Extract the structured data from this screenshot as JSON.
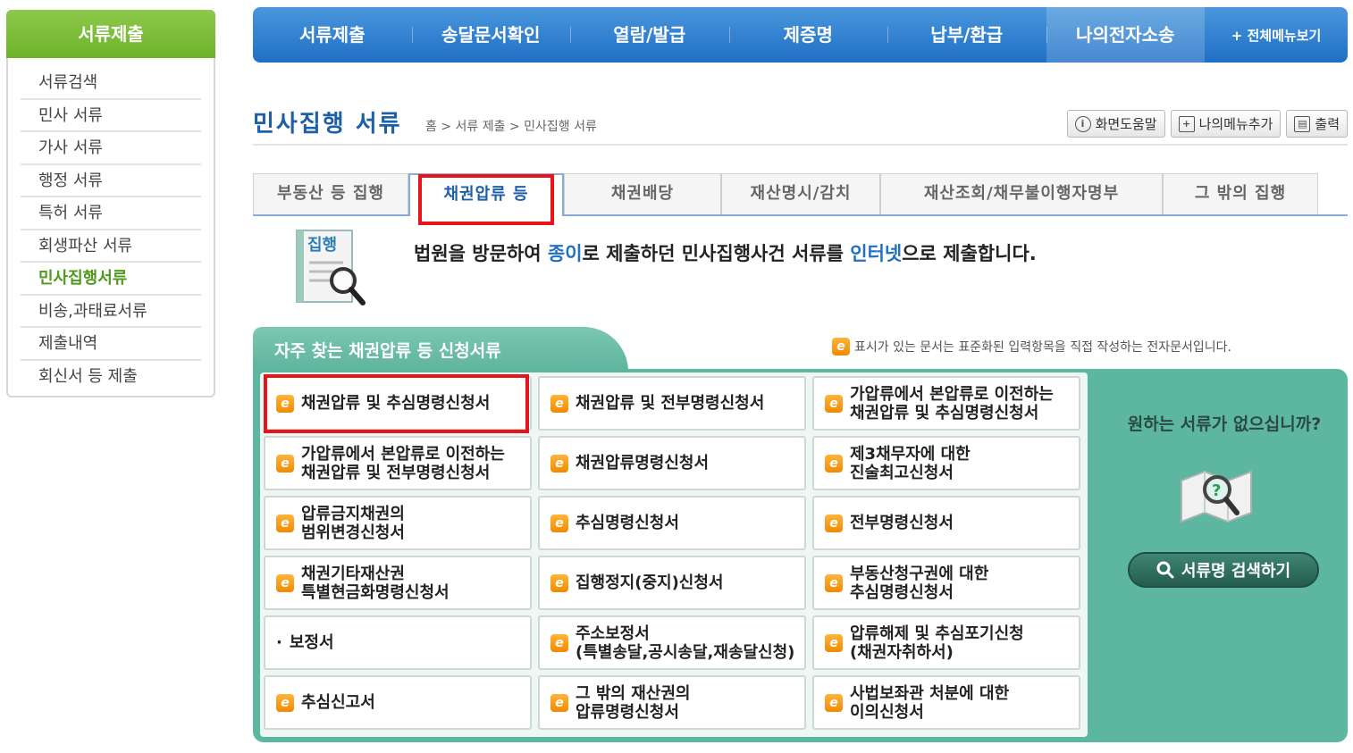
{
  "sidebar": {
    "title": "서류제출",
    "items": [
      {
        "label": "서류검색"
      },
      {
        "label": "민사 서류"
      },
      {
        "label": "가사 서류"
      },
      {
        "label": "행정 서류"
      },
      {
        "label": "특허 서류"
      },
      {
        "label": "회생파산 서류"
      },
      {
        "label": "민사집행서류"
      },
      {
        "label": "비송,과태료서류"
      },
      {
        "label": "제출내역"
      },
      {
        "label": "회신서 등 제출"
      }
    ],
    "active_index": 6
  },
  "topnav": {
    "items": [
      "서류제출",
      "송달문서확인",
      "열람/발급",
      "제증명",
      "납부/환급",
      "나의전자소송"
    ],
    "all_menu": "+ 전체메뉴보기"
  },
  "page": {
    "title": "민사집행 서류",
    "breadcrumb": "홈 > 서류 제출 > 민사집행 서류",
    "tools": {
      "help": "화면도움말",
      "add_menu": "나의메뉴추가",
      "print": "출력"
    }
  },
  "tabs": [
    "부동산 등 집행",
    "채권압류 등",
    "채권배당",
    "재산명시/감치",
    "재산조회/채무불이행자명부",
    "그 밖의 집행"
  ],
  "intro": {
    "icon_label": "집행",
    "text_a": "법원을 방문하여 ",
    "text_hl1": "종이",
    "text_b": "로 제출하던 민사집행사건 서류를 ",
    "text_hl2": "인터넷",
    "text_c": "으로 제출합니다."
  },
  "section": {
    "title": "자주 찾는 채권압류 등 신청서류",
    "note": "표시가 있는 문서는 표준화된 입력항목을 직접 작성하는 전자문서입니다."
  },
  "documents": [
    {
      "label": "채권압류 및 추심명령신청서",
      "icon": "e"
    },
    {
      "label": "채권압류 및 전부명령신청서",
      "icon": "e"
    },
    {
      "label": "가압류에서 본압류로 이전하는\n채권압류 및 추심명령신청서",
      "icon": "e"
    },
    {
      "label": "가압류에서 본압류로 이전하는\n채권압류 및 전부명령신청서",
      "icon": "e"
    },
    {
      "label": "채권압류명령신청서",
      "icon": "e"
    },
    {
      "label": "제3채무자에 대한\n진술최고신청서",
      "icon": "e"
    },
    {
      "label": "압류금지채권의\n범위변경신청서",
      "icon": "e"
    },
    {
      "label": "추심명령신청서",
      "icon": "e"
    },
    {
      "label": "전부명령신청서",
      "icon": "e"
    },
    {
      "label": "채권기타재산권\n특별현금화명령신청서",
      "icon": "e"
    },
    {
      "label": "집행정지(중지)신청서",
      "icon": "e"
    },
    {
      "label": "부동산청구권에 대한\n추심명령신청서",
      "icon": "e"
    },
    {
      "label": "보정서",
      "icon": "dot"
    },
    {
      "label": "주소보정서\n(특별송달,공시송달,재송달신청)",
      "icon": "e"
    },
    {
      "label": "압류해제 및 추심포기신청\n(채권자취하서)",
      "icon": "e"
    },
    {
      "label": "추심신고서",
      "icon": "e"
    },
    {
      "label": "그 밖의 재산권의\n압류명령신청서",
      "icon": "e"
    },
    {
      "label": "사법보좌관 처분에 대한\n이의신청서",
      "icon": "e"
    }
  ],
  "side": {
    "question": "원하는 서류가 없으십니까?",
    "search_button": "서류명 검색하기"
  },
  "colors": {
    "nav_blue": "#2a7fd0",
    "sidebar_green": "#6db22b",
    "panel_teal": "#5db69f",
    "highlight_red": "#e8141a"
  }
}
